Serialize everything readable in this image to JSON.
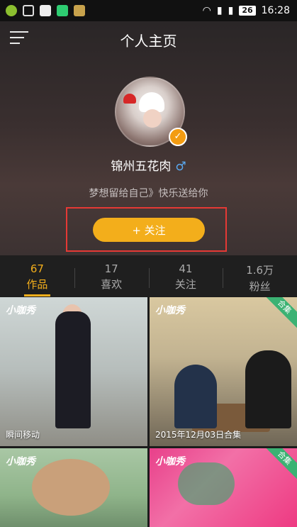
{
  "status_bar": {
    "battery": "26",
    "time": "16:28"
  },
  "header": {
    "title": "个人主页"
  },
  "profile": {
    "username": "锦州五花肉",
    "gender_symbol": "♂",
    "signature": "梦想留给自己》快乐送给你",
    "follow_label": "+ 关注"
  },
  "stats": [
    {
      "num": "67",
      "label": "作品"
    },
    {
      "num": "17",
      "label": "喜欢"
    },
    {
      "num": "41",
      "label": "关注"
    },
    {
      "num": "1.6万",
      "label": "粉丝"
    }
  ],
  "videos": [
    {
      "logo": "小咖秀",
      "caption": "瞬间移动",
      "badge": ""
    },
    {
      "logo": "小咖秀",
      "caption": "2015年12月03日合集",
      "badge": "合集"
    },
    {
      "logo": "小咖秀",
      "caption": "",
      "badge": ""
    },
    {
      "logo": "小咖秀",
      "caption": "",
      "badge": "合集"
    }
  ],
  "colors": {
    "accent": "#f3ae1b",
    "highlight_frame": "#e53935",
    "gender": "#5aa9f0",
    "badge": "#3bb273"
  }
}
